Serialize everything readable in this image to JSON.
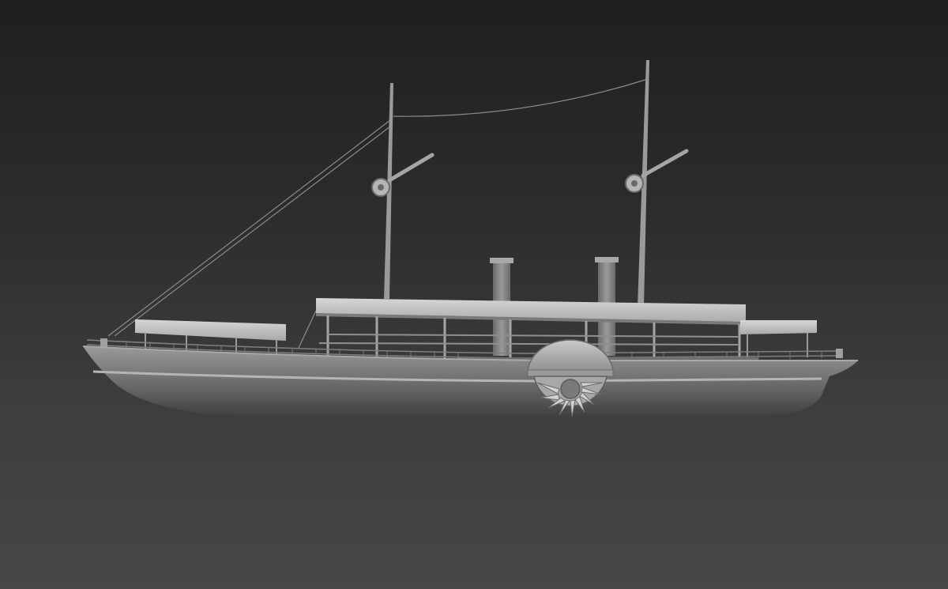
{
  "scene": {
    "background_top": "#1f1f1f",
    "background_bottom": "#474747",
    "model_color": "#9a9a9a",
    "hull_dark": "#5a5a5a",
    "hull_light": "#8c8c8c",
    "awning_color": "#c8c8c8"
  },
  "model": {
    "subject": "paddle-steamer-icon"
  }
}
